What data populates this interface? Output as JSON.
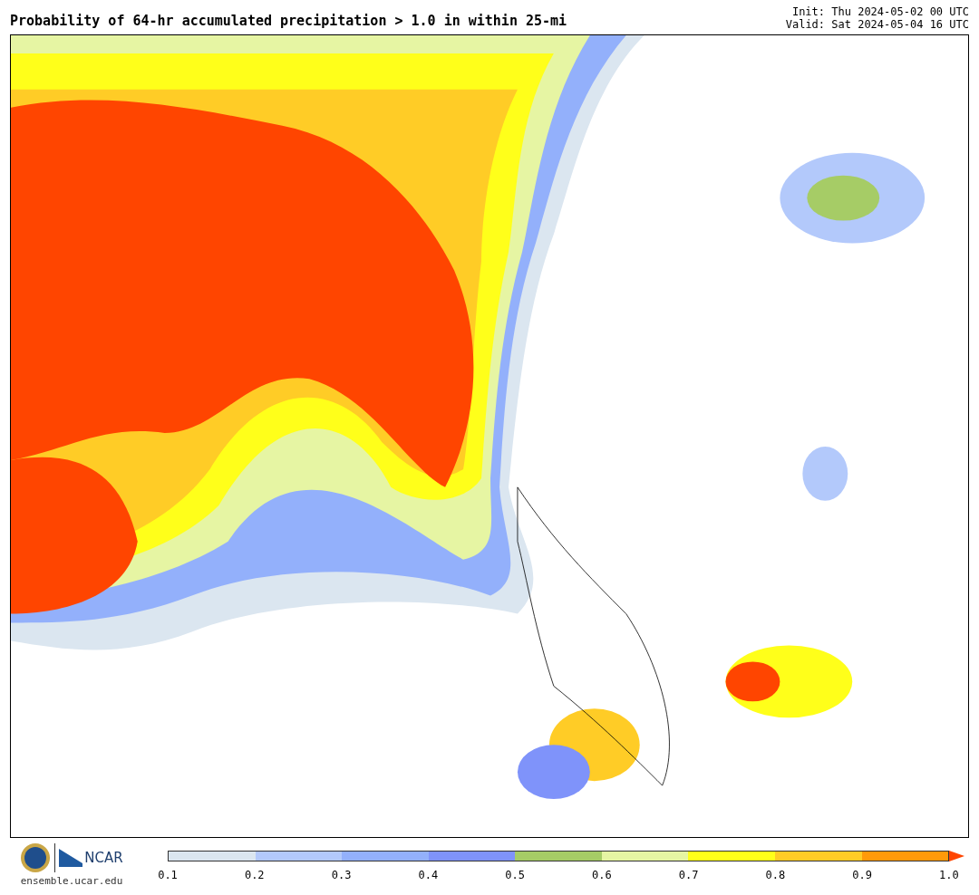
{
  "title": "Probability of 64-hr accumulated precipitation > 1.0 in within 25-mi",
  "init": "Init: Thu 2024-05-02 00 UTC",
  "valid": "Valid: Sat 2024-05-04 16 UTC",
  "footer": {
    "logo_text": "NCAR",
    "site": "ensemble.ucar.edu"
  },
  "colorbar": {
    "bins": [
      {
        "color": "#dbe6f0"
      },
      {
        "color": "#b3c9fb"
      },
      {
        "color": "#93b0fb"
      },
      {
        "color": "#7f93fa"
      },
      {
        "color": "#a6cc66"
      },
      {
        "color": "#e6f5a3"
      },
      {
        "color": "#ffff1a"
      },
      {
        "color": "#ffcc26"
      },
      {
        "color": "#ff9a0a"
      }
    ],
    "extension": {
      "color": "#ff4500"
    },
    "ticks": [
      "0.1",
      "0.2",
      "0.3",
      "0.4",
      "0.5",
      "0.6",
      "0.7",
      "0.8",
      "0.9",
      "1.0"
    ]
  }
}
